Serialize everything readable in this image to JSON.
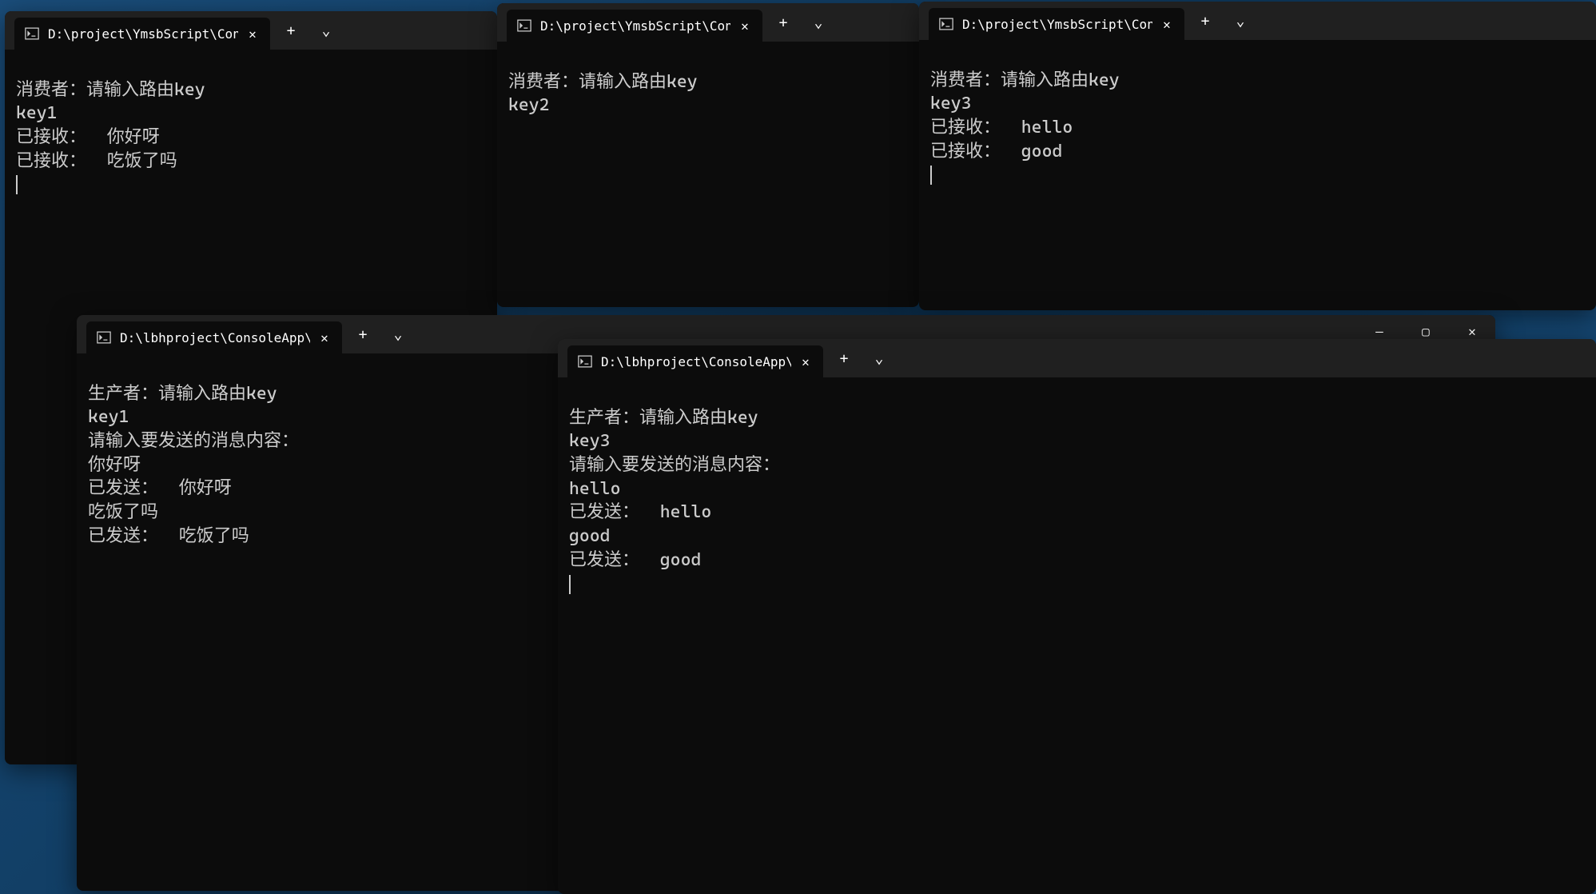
{
  "windows": [
    {
      "id": "w1",
      "tab_title": "D:\\project\\YmsbScript\\Conso",
      "lines": [
        "消费者：请输入路由key",
        "key1",
        "已接收：  你好呀",
        "已接收：  吃饭了吗"
      ]
    },
    {
      "id": "w2",
      "tab_title": "D:\\project\\YmsbScript\\Conso",
      "lines": [
        "消费者：请输入路由key",
        "key2"
      ]
    },
    {
      "id": "w3",
      "tab_title": "D:\\project\\YmsbScript\\Conso",
      "lines": [
        "消费者：请输入路由key",
        "key3",
        "已接收：  hello",
        "已接收：  good"
      ]
    },
    {
      "id": "w4",
      "tab_title": "D:\\lbhproject\\ConsoleApp\\Cc",
      "lines": [
        "生产者：请输入路由key",
        "key1",
        "请输入要发送的消息内容：",
        "你好呀",
        "已发送：  你好呀",
        "吃饭了吗",
        "已发送：  吃饭了吗"
      ]
    },
    {
      "id": "w5",
      "tab_title": "D:\\lbhproject\\ConsoleApp\\Cc",
      "lines": [
        "生产者：请输入路由key",
        "key3",
        "请输入要发送的消息内容：",
        "hello",
        "已发送：  hello",
        "good",
        "已发送：  good"
      ]
    }
  ],
  "icons": {
    "new_tab": "+",
    "dropdown": "⌄",
    "close": "✕",
    "minimize": "―",
    "maximize": "▢"
  }
}
